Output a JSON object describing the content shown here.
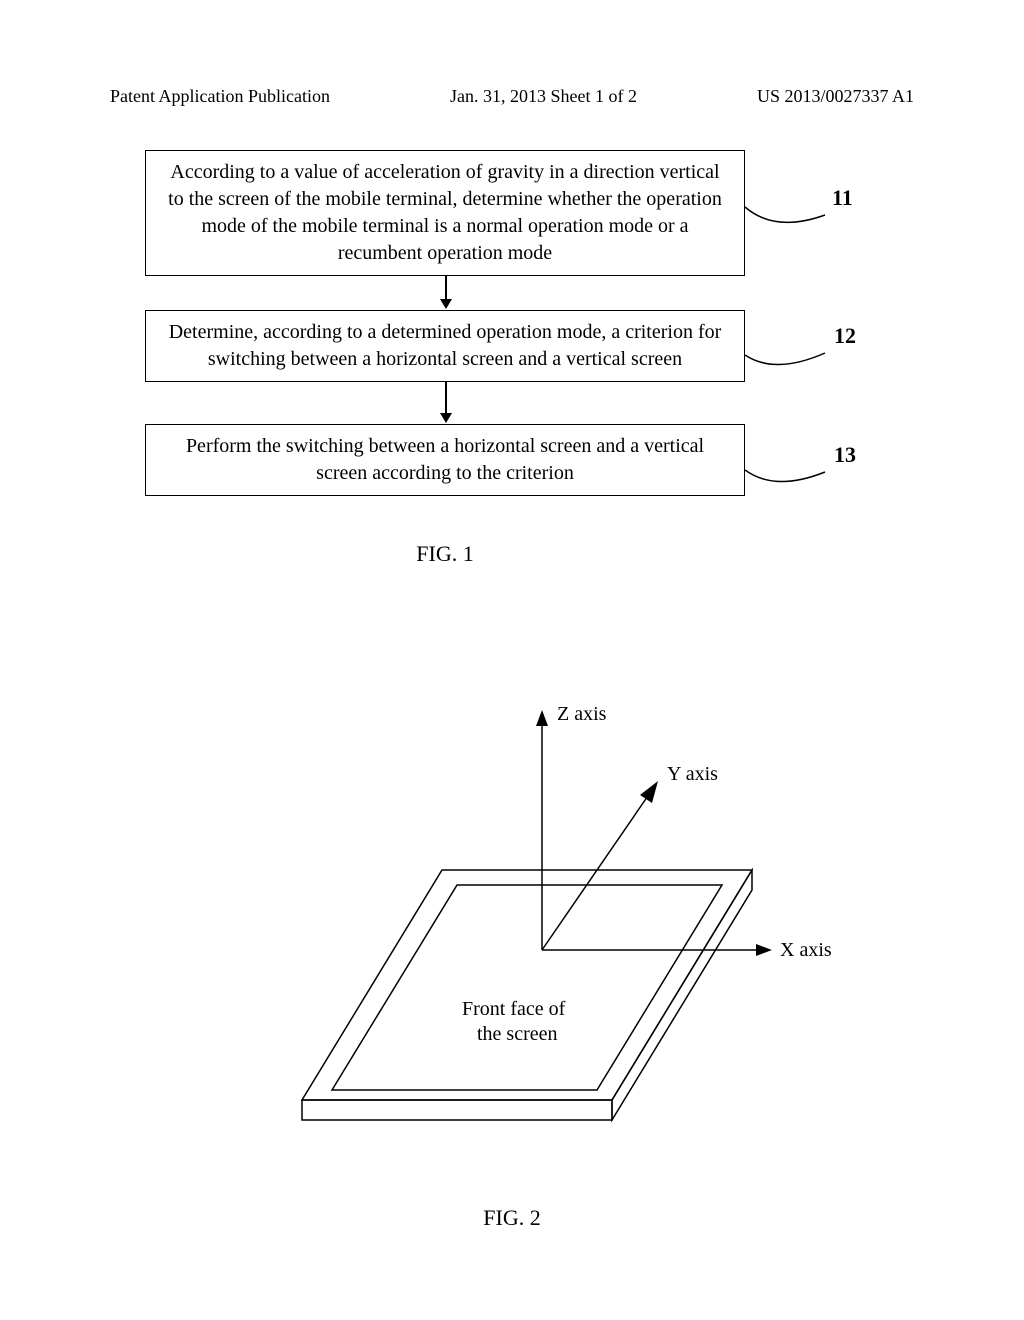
{
  "header": {
    "left": "Patent Application Publication",
    "center": "Jan. 31, 2013  Sheet 1 of 2",
    "right": "US 2013/0027337 A1"
  },
  "flowchart": {
    "boxes": [
      {
        "text": "According to a value of acceleration of gravity in a direction vertical to the screen of the mobile terminal, determine whether the operation mode of the mobile terminal is a normal operation mode or a recumbent operation mode",
        "ref": "11"
      },
      {
        "text": "Determine, according to a determined operation mode, a criterion for switching between a horizontal screen and a vertical screen",
        "ref": "12"
      },
      {
        "text": "Perform the switching between a horizontal screen and a vertical screen according to the criterion",
        "ref": "13"
      }
    ]
  },
  "captions": {
    "fig1": "FIG. 1",
    "fig2": "FIG. 2"
  },
  "axes": {
    "z": "Z axis",
    "y": "Y axis",
    "x": "X axis",
    "screen_line1": "Front face of",
    "screen_line2": "the screen"
  }
}
